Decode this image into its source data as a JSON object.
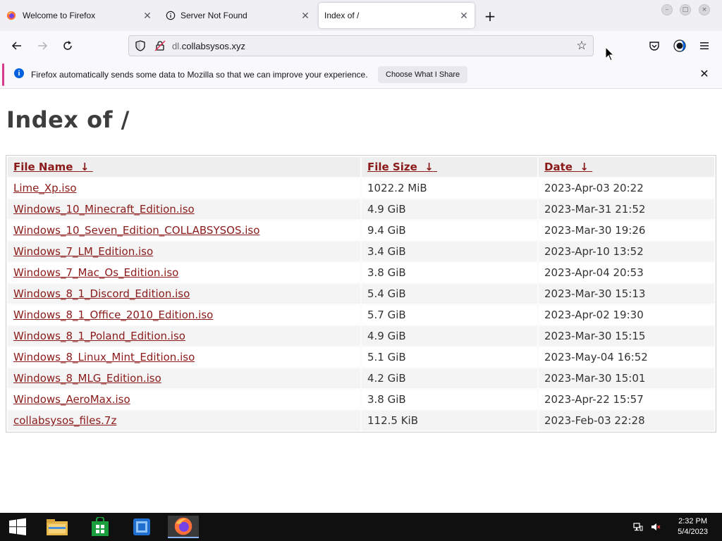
{
  "tabs": [
    {
      "label": "Welcome to Firefox",
      "icon": "firefox-icon",
      "active": false
    },
    {
      "label": "Server Not Found",
      "icon": "info-icon",
      "active": false
    },
    {
      "label": "Index of /",
      "icon": "none",
      "active": true
    }
  ],
  "tab_close_glyph": "✕",
  "new_tab_glyph": "+",
  "navbar": {
    "url_prefix": "dl.",
    "url_domain": "collabsysos.xyz"
  },
  "notification": {
    "text": "Firefox automatically sends some data to Mozilla so that we can improve your experience.",
    "button_label": "Choose What I Share",
    "info_glyph": "i",
    "close_glyph": "✕"
  },
  "page": {
    "title": "Index of /"
  },
  "table": {
    "headers": [
      {
        "label": "File Name",
        "sort": "↓"
      },
      {
        "label": "File Size",
        "sort": "↓"
      },
      {
        "label": "Date",
        "sort": "↓"
      }
    ],
    "rows": [
      {
        "name": "Lime_Xp.iso",
        "size": "1022.2 MiB",
        "date": "2023-Apr-03 20:22"
      },
      {
        "name": "Windows_10_Minecraft_Edition.iso",
        "size": "4.9 GiB",
        "date": "2023-Mar-31 21:52"
      },
      {
        "name": "Windows_10_Seven_Edition_COLLABSYSOS.iso",
        "size": "9.4 GiB",
        "date": "2023-Mar-30 19:26"
      },
      {
        "name": "Windows_7_LM_Edition.iso",
        "size": "3.4 GiB",
        "date": "2023-Apr-10 13:52"
      },
      {
        "name": "Windows_7_Mac_Os_Edition.iso",
        "size": "3.8 GiB",
        "date": "2023-Apr-04 20:53"
      },
      {
        "name": "Windows_8_1_Discord_Edition.iso",
        "size": "5.4 GiB",
        "date": "2023-Mar-30 15:13"
      },
      {
        "name": "Windows_8_1_Office_2010_Edition.iso",
        "size": "5.7 GiB",
        "date": "2023-Apr-02 19:30"
      },
      {
        "name": "Windows_8_1_Poland_Edition.iso",
        "size": "4.9 GiB",
        "date": "2023-Mar-30 15:15"
      },
      {
        "name": "Windows_8_Linux_Mint_Edition.iso",
        "size": "5.1 GiB",
        "date": "2023-May-04 16:52"
      },
      {
        "name": "Windows_8_MLG_Edition.iso",
        "size": "4.2 GiB",
        "date": "2023-Mar-30 15:01"
      },
      {
        "name": "Windows_AeroMax.iso",
        "size": "3.8 GiB",
        "date": "2023-Apr-22 15:57"
      },
      {
        "name": "collabsysos_files.7z",
        "size": "112.5 KiB",
        "date": "2023-Feb-03 22:28"
      }
    ]
  },
  "taskbar": {
    "time": "2:32 PM",
    "date": "5/4/2023",
    "apps": [
      "windows-start-icon",
      "file-explorer-icon",
      "store-icon",
      "virtualbox-icon",
      "firefox-icon"
    ]
  },
  "colors": {
    "link": "#8b1a1a",
    "accent": "#0060df",
    "notification_stripe": "#d63a8b"
  }
}
